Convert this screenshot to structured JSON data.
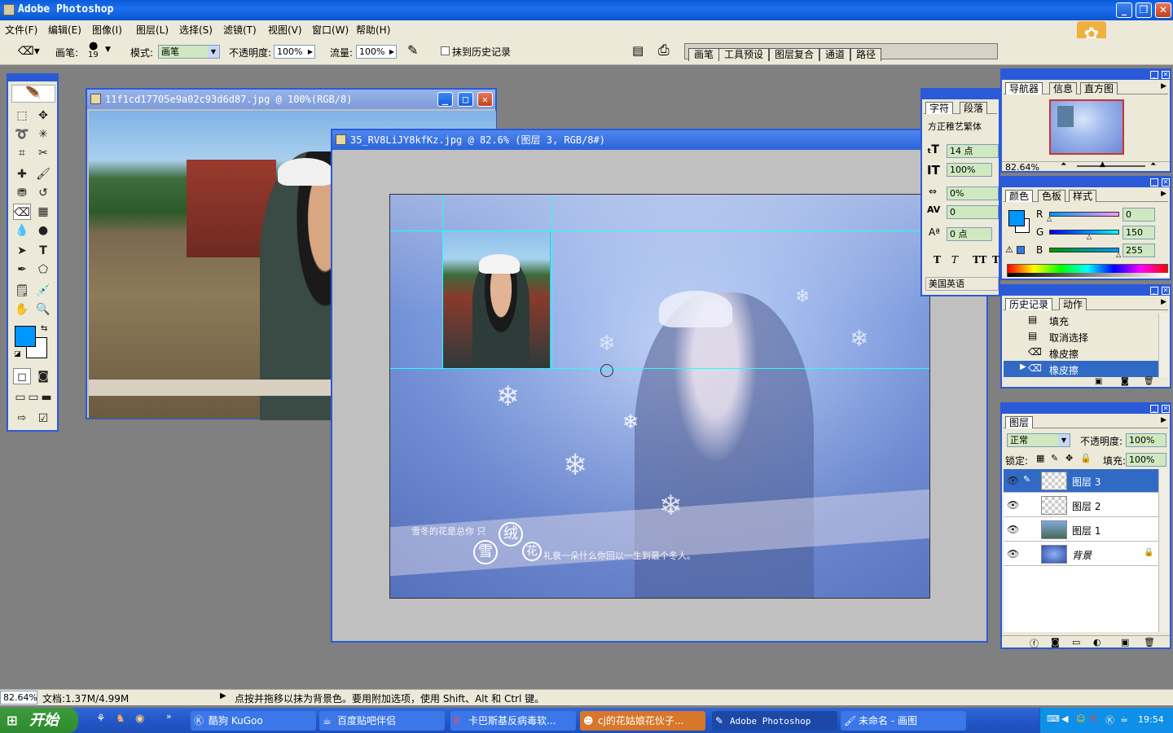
{
  "app": {
    "title": "Adobe Photoshop"
  },
  "menu": [
    "文件(F)",
    "编辑(E)",
    "图像(I)",
    "图层(L)",
    "选择(S)",
    "滤镜(T)",
    "视图(V)",
    "窗口(W)",
    "帮助(H)"
  ],
  "options": {
    "brush_label": "画笔:",
    "brush_size": "19",
    "mode_label": "模式:",
    "mode_value": "画笔",
    "opacity_label": "不透明度:",
    "opacity_value": "100%",
    "flow_label": "流量:",
    "flow_value": "100%",
    "erase_history_label": "抹到历史记录",
    "palette_tabs": [
      "画笔",
      "工具预设",
      "图层复合",
      "通道",
      "路径"
    ]
  },
  "doc1": {
    "title": "11f1cd17705e9a02c93d6d87.jpg @ 100%(RGB/8)"
  },
  "doc2": {
    "title": "35_RV8LiJY8kfKz.jpg @ 82.6% (图层 3, RGB/8#)",
    "caption_left": "雪冬的花是总你 只",
    "seal_chars": [
      "雪",
      "绒",
      "花"
    ],
    "caption_right": "礼衰一朵什么你回以一生到最个冬人。"
  },
  "character_panel": {
    "tabs": [
      "字符",
      "段落"
    ],
    "font": "方正稚艺繁体",
    "size": "14 点",
    "vscale": "100%",
    "tracking": "0%",
    "kerning": "0",
    "baseline": "0 点",
    "language": "美国英语",
    "style_buttons": [
      "T",
      "T",
      "TT",
      "T"
    ]
  },
  "navigator_panel": {
    "tabs": [
      "导航器",
      "信息",
      "直方图"
    ],
    "zoom": "82.64%"
  },
  "color_panel": {
    "tabs": [
      "颜色",
      "色板",
      "样式"
    ],
    "channels": [
      {
        "label": "R",
        "value": "0"
      },
      {
        "label": "G",
        "value": "150"
      },
      {
        "label": "B",
        "value": "255"
      }
    ],
    "foreground": "#0096ff"
  },
  "history_panel": {
    "tabs": [
      "历史记录",
      "动作"
    ],
    "items": [
      "填充",
      "取消选择",
      "橡皮擦",
      "橡皮擦"
    ]
  },
  "layers_panel": {
    "tab": "图层",
    "blend_mode": "正常",
    "opacity_label": "不透明度:",
    "opacity_value": "100%",
    "lock_label": "锁定:",
    "fill_label": "填充:",
    "fill_value": "100%",
    "layers": [
      "图层 3",
      "图层 2",
      "图层 1",
      "背景"
    ]
  },
  "status": {
    "zoom": "82.64%",
    "doc_info": "文档:1.37M/4.99M",
    "hint": "点按并拖移以抹为背景色。要用附加选项，使用 Shift、Alt 和 Ctrl 键。"
  },
  "taskbar": {
    "start": "开始",
    "tasks": [
      "酷狗 KuGoo",
      "百度贴吧伴侣",
      "卡巴斯基反病毒软...",
      "cj的花姑娘花伙子...",
      "Adobe Photoshop",
      "未命名 - 画图"
    ],
    "time": "19:54"
  }
}
